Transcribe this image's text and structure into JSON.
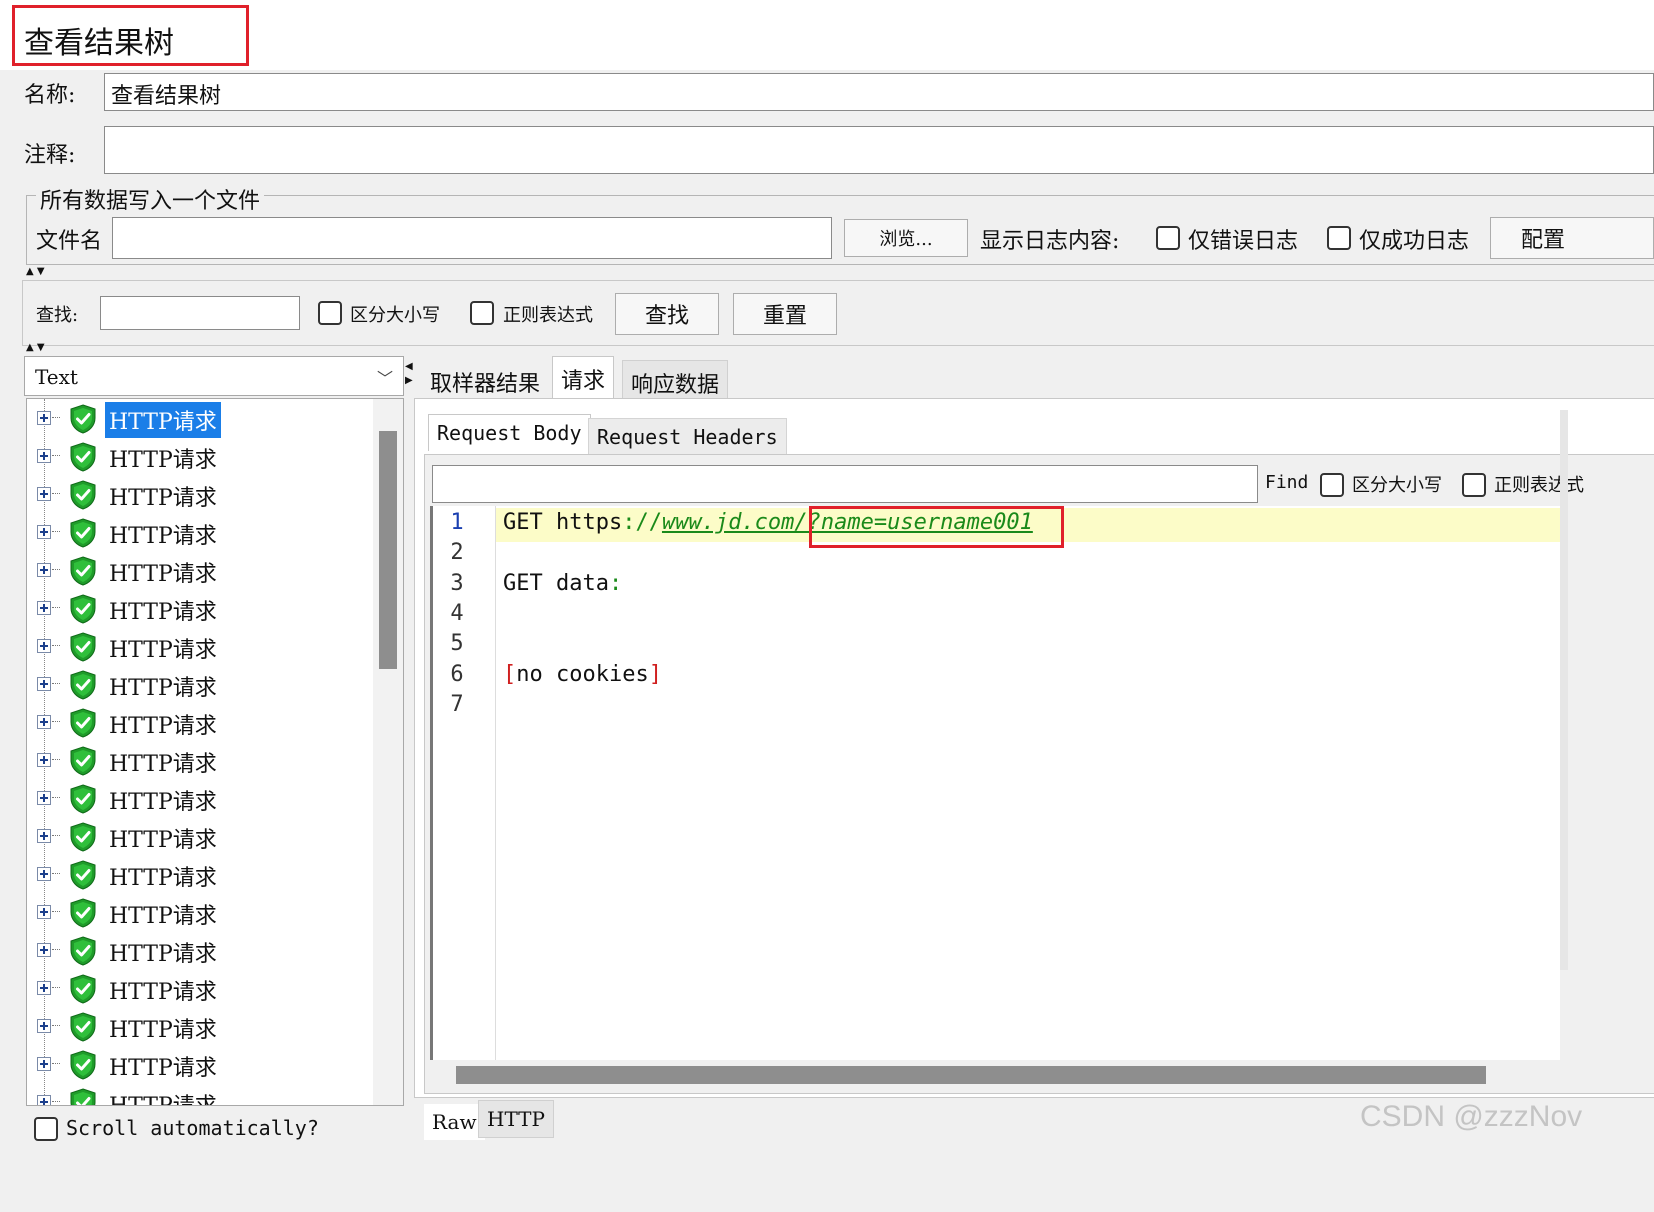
{
  "header": {
    "title": "查看结果树"
  },
  "form": {
    "name_label": "名称:",
    "name_value": "查看结果树",
    "comment_label": "注释:",
    "comment_value": ""
  },
  "file_group": {
    "legend": "所有数据写入一个文件",
    "filename_label": "文件名",
    "filename_value": "",
    "browse_button": "浏览...",
    "log_label": "显示日志内容:",
    "errors_only": "仅错误日志",
    "success_only": "仅成功日志",
    "config_button": "配置"
  },
  "search": {
    "label": "查找:",
    "value": "",
    "case_sensitive": "区分大小写",
    "regex": "正则表达式",
    "find_button": "查找",
    "reset_button": "重置"
  },
  "left_panel": {
    "renderer": "Text",
    "tree_items": [
      "HTTP请求",
      "HTTP请求",
      "HTTP请求",
      "HTTP请求",
      "HTTP请求",
      "HTTP请求",
      "HTTP请求",
      "HTTP请求",
      "HTTP请求",
      "HTTP请求",
      "HTTP请求",
      "HTTP请求",
      "HTTP请求",
      "HTTP请求",
      "HTTP请求",
      "HTTP请求",
      "HTTP请求",
      "HTTP请求",
      "HTTP请求"
    ],
    "selected_index": 0,
    "scroll_auto": "Scroll automatically?"
  },
  "right_panel": {
    "tabs": [
      "取样器结果",
      "请求",
      "响应数据"
    ],
    "active_tab": 1,
    "subtabs": [
      "Request Body",
      "Request Headers"
    ],
    "active_subtab": 0,
    "find_label": "Find",
    "find_value": "",
    "find_case": "区分大小写",
    "find_regex": "正则表达式",
    "line_numbers": [
      "1",
      "2",
      "3",
      "4",
      "5",
      "6",
      "7"
    ],
    "code": {
      "l1_method": "GET ",
      "l1_scheme": "https",
      "l1_sep": "://",
      "l1_url": "www.jd.com/?name=username001",
      "l3_text": "GET data",
      "l3_colon": ":",
      "l6_open": "[",
      "l6_text": "no cookies",
      "l6_close": "]"
    },
    "bottom_tabs": [
      "Raw",
      "HTTP"
    ]
  },
  "watermark": "CSDN @zzzNov",
  "colors": {
    "highlight_box": "#e0202a",
    "selection": "#1a7ee8",
    "url": "#1a8a1a",
    "current_line": "#fcfcc8"
  }
}
